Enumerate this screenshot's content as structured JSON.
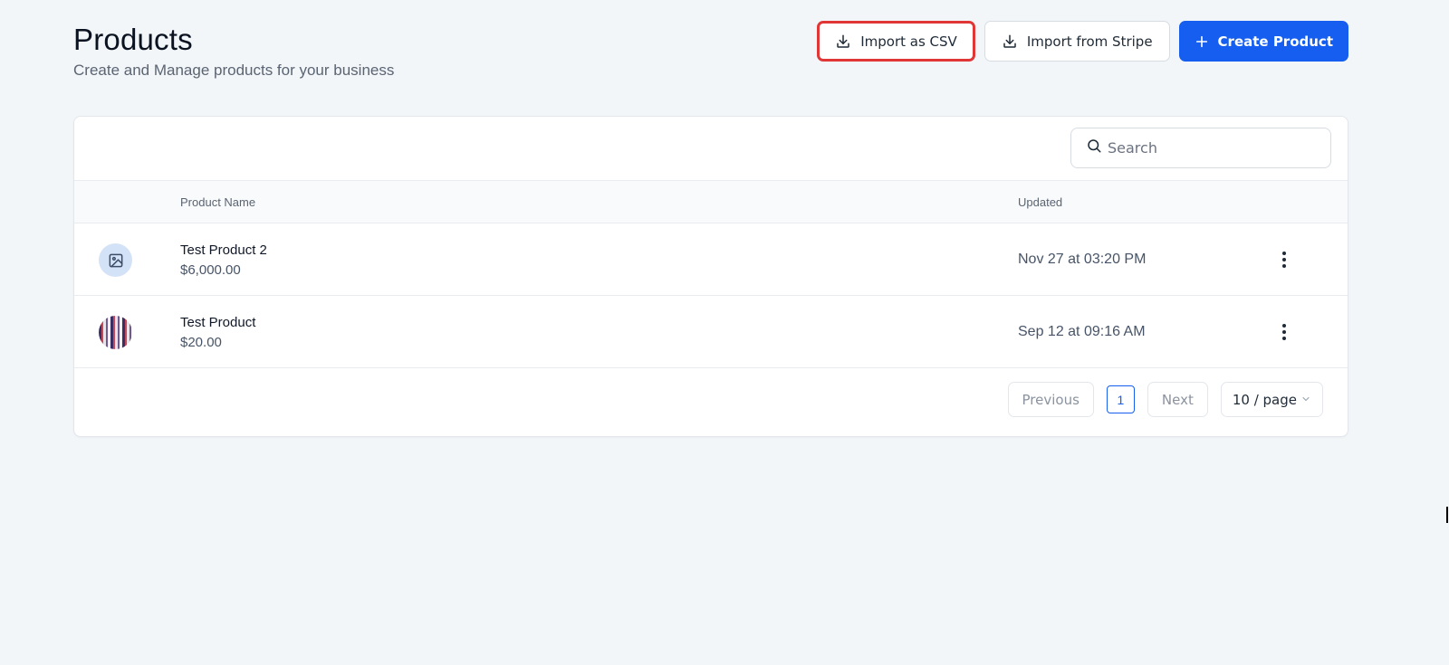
{
  "header": {
    "title": "Products",
    "subtitle": "Create and Manage products for your business"
  },
  "actions": {
    "import_csv_label": "Import as CSV",
    "import_stripe_label": "Import from Stripe",
    "create_label": "Create Product"
  },
  "search": {
    "placeholder": "Search",
    "value": ""
  },
  "table": {
    "columns": {
      "name": "Product Name",
      "updated": "Updated"
    },
    "rows": [
      {
        "name": "Test Product 2",
        "price": "$6,000.00",
        "updated": "Nov 27 at 03:20 PM",
        "thumbnail": "image-placeholder-icon"
      },
      {
        "name": "Test Product",
        "price": "$20.00",
        "updated": "Sep 12 at 09:16 AM",
        "thumbnail": "product-image"
      }
    ]
  },
  "pagination": {
    "previous_label": "Previous",
    "current_page": "1",
    "next_label": "Next",
    "page_size": "10 / page"
  },
  "colors": {
    "primary": "#155eef",
    "highlight": "#e03636",
    "background": "#f2f6f9"
  }
}
